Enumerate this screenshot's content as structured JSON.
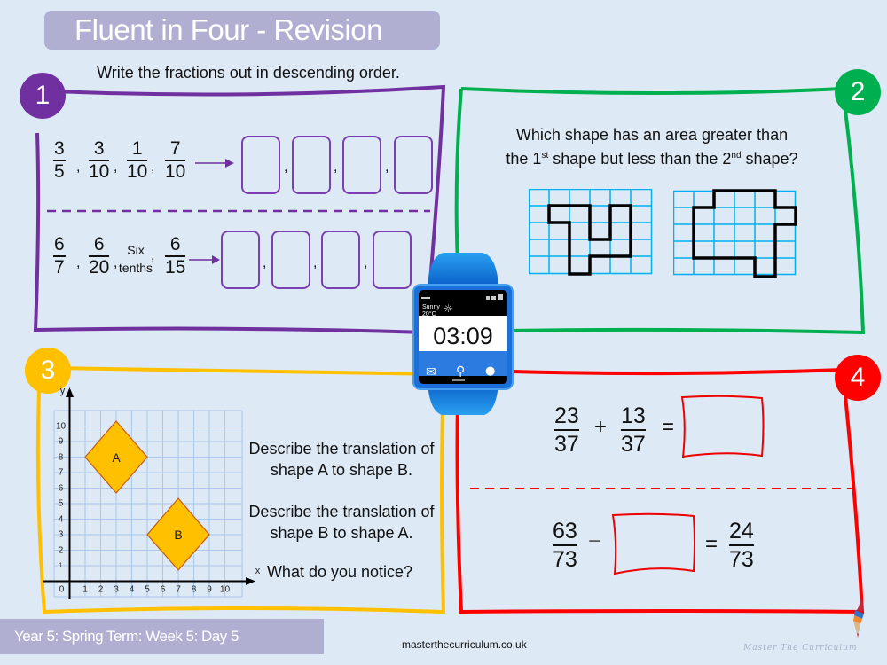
{
  "header": {
    "title": "Fluent in Four - Revision"
  },
  "colors": {
    "background": "#dde9f5",
    "title_bar": "#b1afd1",
    "q1": "#7030a0",
    "q2": "#00b050",
    "q3": "#ffc000",
    "q4": "#ff0000",
    "grid_line": "#00b0f0"
  },
  "q1": {
    "badge": "1",
    "instruction": "Write the fractions out in descending order.",
    "row1": {
      "items": [
        {
          "num": "3",
          "den": "5"
        },
        {
          "num": "3",
          "den": "10"
        },
        {
          "num": "1",
          "den": "10"
        },
        {
          "num": "7",
          "den": "10"
        }
      ],
      "answer_boxes": 4
    },
    "row2": {
      "items": [
        {
          "num": "6",
          "den": "7"
        },
        {
          "num": "6",
          "den": "20"
        },
        {
          "words": [
            "Six",
            "tenths"
          ]
        },
        {
          "num": "6",
          "den": "15"
        }
      ],
      "answer_boxes": 4
    },
    "separator": ","
  },
  "q2": {
    "badge": "2",
    "question_line1": "Which shape has an area greater than",
    "question_line2_a": "the 1",
    "sup1": "st",
    "question_line2_b": " shape but less than the 2",
    "sup2": "nd",
    "question_line2_c": " shape?",
    "shapes": [
      {
        "name": "shape-1",
        "grid_cols": 6,
        "grid_rows": 5
      },
      {
        "name": "shape-2",
        "grid_cols": 6,
        "grid_rows": 5
      }
    ]
  },
  "watch": {
    "weather_label": "Sunny",
    "temperature": "20°C",
    "time": "03:09",
    "icons": [
      "mail-icon",
      "search-icon",
      "user-icon"
    ]
  },
  "q3": {
    "badge": "3",
    "axis_x_label": "x",
    "axis_y_label": "y",
    "x_ticks": [
      "0",
      "1",
      "2",
      "3",
      "4",
      "5",
      "6",
      "7",
      "8",
      "9",
      "10"
    ],
    "y_ticks": [
      "1",
      "2",
      "3",
      "4",
      "5",
      "6",
      "7",
      "8",
      "9",
      "10"
    ],
    "shape_a": {
      "label": "A",
      "center": [
        3,
        8
      ]
    },
    "shape_b": {
      "label": "B",
      "center": [
        7,
        3
      ]
    },
    "prompt1_line1": "Describe the translation of",
    "prompt1_line2": "shape A to shape B.",
    "prompt2_line1": "Describe the translation of",
    "prompt2_line2": "shape B to shape A.",
    "prompt3": "What do you notice?"
  },
  "q4": {
    "badge": "4",
    "eq1": {
      "a_num": "23",
      "a_den": "37",
      "op": "+",
      "b_num": "13",
      "b_den": "37",
      "equals": "="
    },
    "eq2": {
      "a_num": "63",
      "a_den": "73",
      "op": "−",
      "equals": "=",
      "r_num": "24",
      "r_den": "73"
    }
  },
  "footer": {
    "label": "Year 5: Spring Term: Week 5: Day 5",
    "site": "masterthecurriculum.co.uk",
    "brand": "Master The Curriculum"
  }
}
